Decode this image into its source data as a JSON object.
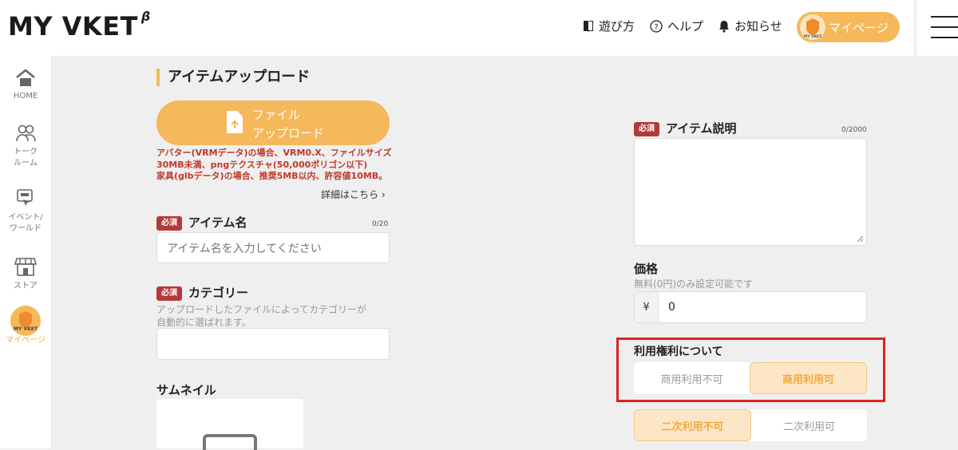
{
  "header": {
    "logo": "MY VKET",
    "logo_sup": "β",
    "nav": [
      {
        "label": "遊び方",
        "icon": "book-icon"
      },
      {
        "label": "ヘルプ",
        "icon": "question-icon"
      },
      {
        "label": "お知らせ",
        "icon": "bell-icon"
      }
    ],
    "mypage_label": "マイページ",
    "avatar_text": "MY VKET"
  },
  "sidebar": {
    "items": [
      {
        "label": "HOME",
        "icon": "home-icon"
      },
      {
        "label": "トーク\nルーム",
        "icon": "people-icon"
      },
      {
        "label": "イベント/\nワールド",
        "icon": "event-icon"
      },
      {
        "label": "ストア",
        "icon": "store-icon"
      },
      {
        "label": "マイページ",
        "icon": "avatar-icon",
        "active": true
      }
    ],
    "avatar_text": "MY VKET"
  },
  "form": {
    "section_title": "アイテムアップロード",
    "upload_line1": "ファイル",
    "upload_line2": "アップロード",
    "notes": [
      "アバター(VRMデータ)の場合、VRM0.X、ファイルサイズ",
      "30MB未満、pngテクスチャ(50,000ポリゴン以下)",
      "家具(glbデータ)の場合、推奨5MB以内、許容値10MB。"
    ],
    "more_link": "詳細はこちら",
    "required_badge": "必須",
    "item_name_label": "アイテム名",
    "item_name_counter": "0/20",
    "item_name_placeholder": "アイテム名を入力してください",
    "category_label": "カテゴリー",
    "category_hint": "アップロードしたファイルによってカテゴリーが\n自動的に選ばれます。",
    "category_value": "",
    "thumbnail_label": "サムネイル",
    "desc_label": "アイテム説明",
    "desc_counter": "0/2000",
    "desc_value": "",
    "price_label": "価格",
    "price_hint": "無料(0円)のみ設定可能です",
    "currency": "¥",
    "price_value": "0",
    "rights_label": "利用権利について",
    "commercial_options": [
      "商用利用不可",
      "商用利用可"
    ],
    "commercial_selected": 1,
    "secondary_options": [
      "二次利用不可",
      "二次利用可"
    ],
    "secondary_selected": 0
  },
  "colors": {
    "accent": "#f5b85a",
    "required": "#b33a3a",
    "highlight": "#e02020"
  }
}
